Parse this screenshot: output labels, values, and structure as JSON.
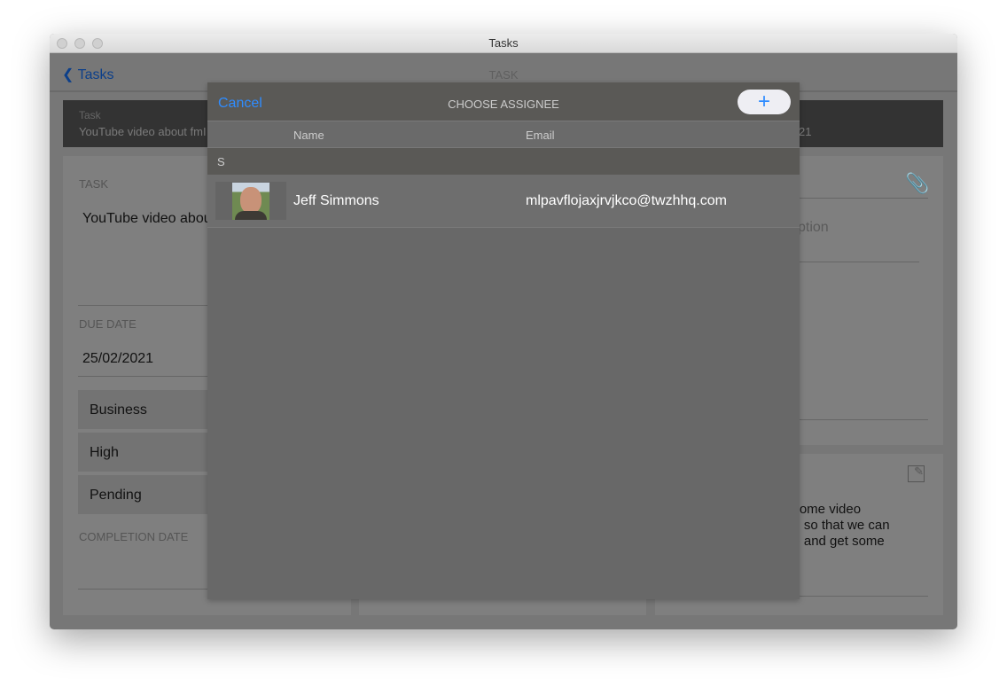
{
  "window": {
    "title": "Tasks"
  },
  "nav": {
    "back_label": "Tasks",
    "title": "TASK"
  },
  "band": {
    "label": "Task",
    "value": "YouTube video about fmI",
    "right_fragment": "21"
  },
  "left_panel": {
    "task_label": "TASK",
    "task_value": "YouTube video abou",
    "due_label": "DUE DATE",
    "due_value": "25/02/2021",
    "category": "Business",
    "priority": "High",
    "status": "Pending",
    "completion_label": "COMPLETION DATE"
  },
  "right_panel": {
    "description_fragment": "ption",
    "note_lines": [
      "esome video",
      "or, so that we can",
      "be and get some"
    ]
  },
  "modal": {
    "cancel_label": "Cancel",
    "title": "CHOOSE ASSIGNEE",
    "add_label": "+",
    "columns": [
      "Name",
      "Email"
    ],
    "section": "S",
    "rows": [
      {
        "name": "Jeff Simmons",
        "email": "mlpavflojaxjrvjkco@twzhhq.com"
      }
    ]
  },
  "colors": {
    "accent": "#2f8cff",
    "back_link": "#0c3f8a"
  }
}
